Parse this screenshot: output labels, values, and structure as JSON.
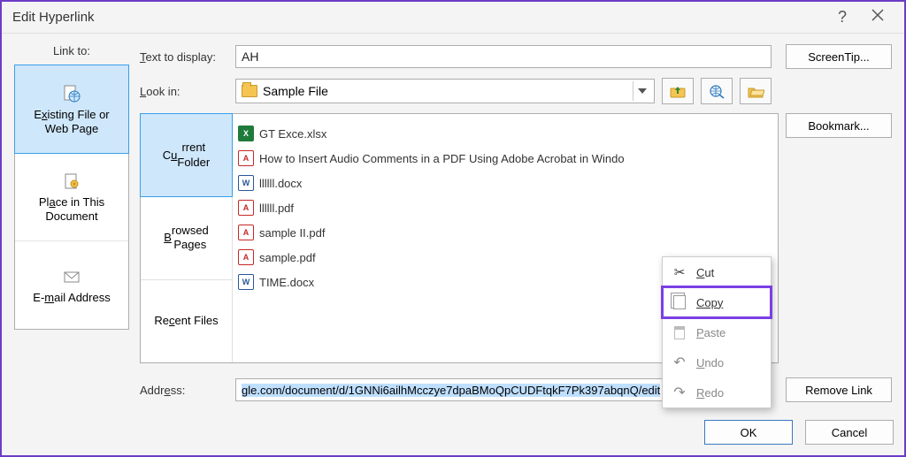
{
  "window": {
    "title": "Edit Hyperlink"
  },
  "linkto": {
    "header": "Link to:",
    "options": {
      "existing": "Existing File or\nWeb Page",
      "place": "Place in This\nDocument",
      "email": "E-mail Address"
    }
  },
  "fields": {
    "text_to_display_label": "Text to display:",
    "text_to_display_value": "AH",
    "lookin_label": "Look in:",
    "lookin_value": "Sample File",
    "address_label": "Address:",
    "address_value": "gle.com/document/d/1GNNi6ailhMcczye7dpaBMoQpCUDFtqkF7Pk397abqnQ/edit"
  },
  "side_tabs": {
    "current": "Current\nFolder",
    "browsed": "Browsed\nPages",
    "recent": "Recent Files"
  },
  "files": [
    {
      "icon": "xlsx",
      "name": "GT Exce.xlsx"
    },
    {
      "icon": "pdf",
      "name": "How to Insert Audio Comments in a PDF Using Adobe Acrobat in Windo"
    },
    {
      "icon": "docx",
      "name": "llllll.docx"
    },
    {
      "icon": "pdf",
      "name": "llllll.pdf"
    },
    {
      "icon": "pdf",
      "name": "sample II.pdf"
    },
    {
      "icon": "pdf",
      "name": "sample.pdf"
    },
    {
      "icon": "docx",
      "name": "TIME.docx"
    }
  ],
  "buttons": {
    "screentip": "ScreenTip...",
    "bookmark": "Bookmark...",
    "remove": "Remove Link",
    "ok": "OK",
    "cancel": "Cancel"
  },
  "context_menu": {
    "cut": "Cut",
    "copy": "Copy",
    "paste": "Paste",
    "undo": "Undo",
    "redo": "Redo"
  }
}
